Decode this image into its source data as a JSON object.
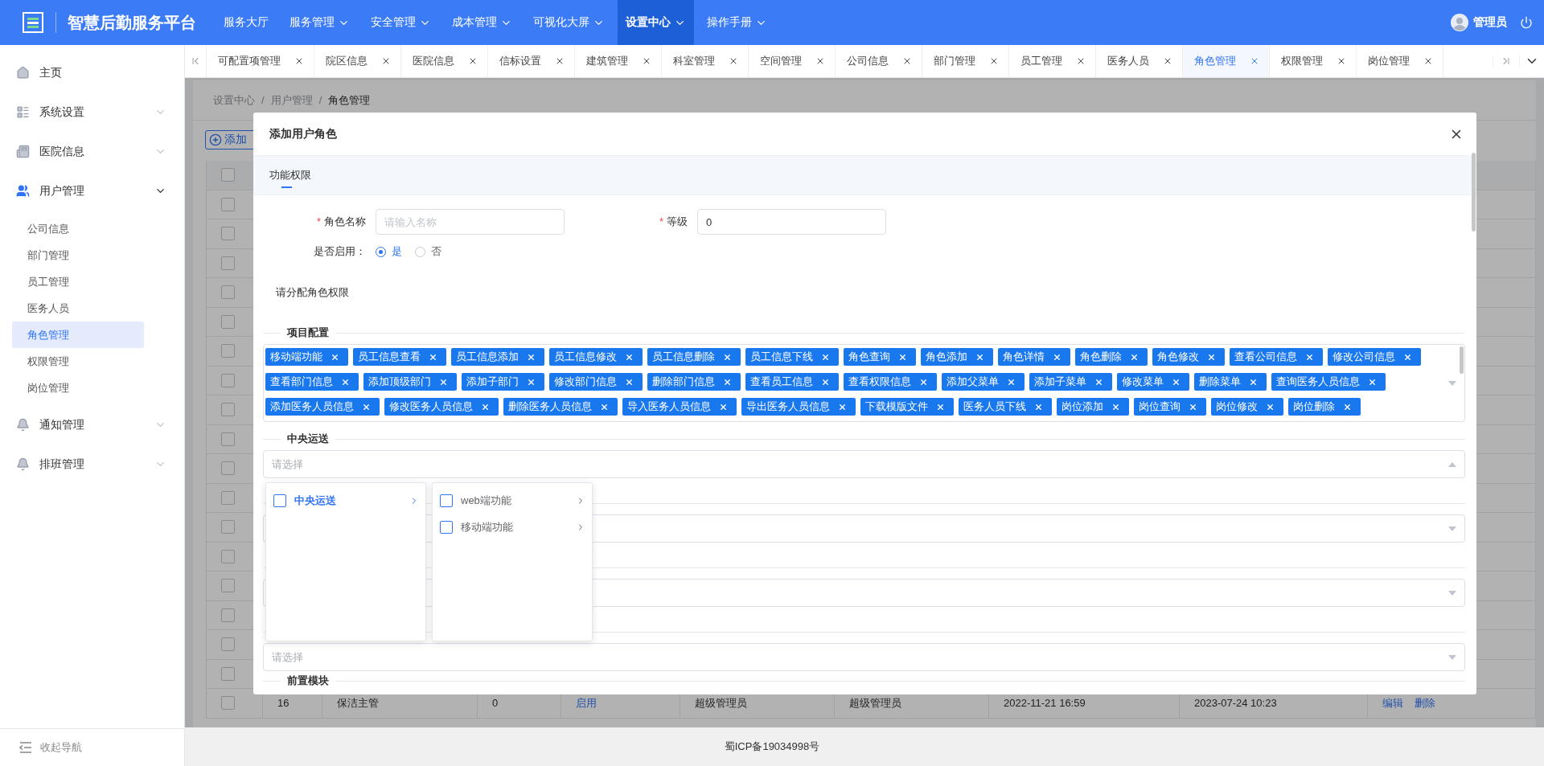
{
  "header": {
    "title": "智慧后勤服务平台",
    "nav": [
      {
        "label": "服务大厅",
        "has_menu": false,
        "selected": false
      },
      {
        "label": "服务管理",
        "has_menu": true,
        "selected": false
      },
      {
        "label": "安全管理",
        "has_menu": true,
        "selected": false
      },
      {
        "label": "成本管理",
        "has_menu": true,
        "selected": false
      },
      {
        "label": "可视化大屏",
        "has_menu": true,
        "selected": false
      },
      {
        "label": "设置中心",
        "has_menu": true,
        "selected": true
      },
      {
        "label": "操作手册",
        "has_menu": true,
        "selected": false
      }
    ],
    "user": "管理员"
  },
  "sidebar": {
    "items": [
      {
        "label": "主页"
      },
      {
        "label": "系统设置",
        "expanded": false
      },
      {
        "label": "医院信息",
        "expanded": false
      },
      {
        "label": "用户管理",
        "expanded": true,
        "children": [
          {
            "label": "公司信息",
            "selected": false
          },
          {
            "label": "部门管理",
            "selected": false
          },
          {
            "label": "员工管理",
            "selected": false
          },
          {
            "label": "医务人员",
            "selected": false
          },
          {
            "label": "角色管理",
            "selected": true
          },
          {
            "label": "权限管理",
            "selected": false
          },
          {
            "label": "岗位管理",
            "selected": false
          }
        ]
      },
      {
        "label": "通知管理",
        "expanded": false
      },
      {
        "label": "排班管理",
        "expanded": false
      }
    ],
    "collapse": "收起导航"
  },
  "tabs": [
    {
      "label": "可配置项管理",
      "selected": false
    },
    {
      "label": "院区信息",
      "selected": false
    },
    {
      "label": "医院信息",
      "selected": false
    },
    {
      "label": "信标设置",
      "selected": false
    },
    {
      "label": "建筑管理",
      "selected": false
    },
    {
      "label": "科室管理",
      "selected": false
    },
    {
      "label": "空间管理",
      "selected": false
    },
    {
      "label": "公司信息",
      "selected": false
    },
    {
      "label": "部门管理",
      "selected": false
    },
    {
      "label": "员工管理",
      "selected": false
    },
    {
      "label": "医务人员",
      "selected": false
    },
    {
      "label": "角色管理",
      "selected": true
    },
    {
      "label": "权限管理",
      "selected": false
    },
    {
      "label": "岗位管理",
      "selected": false
    }
  ],
  "breadcrumb": [
    {
      "label": "设置中心",
      "kind": "crumb"
    },
    {
      "label": "/",
      "kind": "separator"
    },
    {
      "label": "用户管理",
      "kind": "crumb"
    },
    {
      "label": "/",
      "kind": "separator"
    },
    {
      "label": "角色管理",
      "kind": "current"
    }
  ],
  "add_button": "添加",
  "table": {
    "header_checked": false,
    "rows": [
      {
        "checked": false
      },
      {
        "checked": false
      },
      {
        "checked": false
      },
      {
        "checked": false
      },
      {
        "checked": false
      },
      {
        "checked": false
      },
      {
        "checked": false
      },
      {
        "checked": false
      },
      {
        "checked": false
      },
      {
        "checked": false
      },
      {
        "checked": false
      },
      {
        "checked": false
      },
      {
        "checked": false
      },
      {
        "checked": false
      },
      {
        "checked": false
      },
      {
        "checked": false
      },
      {
        "checked": false
      },
      {
        "checked": false,
        "cells": [
          {
            "text": "16",
            "kind": "text"
          },
          {
            "text": "保洁主管",
            "kind": "text"
          },
          {
            "text": "0",
            "kind": "text"
          },
          {
            "text": "启用",
            "kind": "link"
          },
          {
            "text": "超级管理员",
            "kind": "text"
          },
          {
            "text": "超级管理员",
            "kind": "text"
          },
          {
            "text": "2022-11-21 16:59",
            "kind": "text"
          },
          {
            "text": "2023-07-24 10:23",
            "kind": "text"
          }
        ],
        "actions": [
          "编辑",
          "删除"
        ]
      }
    ]
  },
  "dialog": {
    "title": "添加用户角色",
    "tabs": [
      {
        "label": "功能权限",
        "selected": true
      }
    ],
    "fields": [
      {
        "marker": "*",
        "label": "角色名称",
        "placeholder": "请输入名称"
      },
      {
        "marker": "*",
        "label": "等级",
        "value": "0"
      }
    ],
    "enable": {
      "label": "是否启用：",
      "options": [
        {
          "label": "是",
          "selected": true
        },
        {
          "label": "否",
          "selected": false
        }
      ]
    },
    "hint": "请分配角色权限",
    "sections": [
      {
        "title": "项目配置",
        "kind": "tags",
        "open": false,
        "tags": [
          "移动端功能",
          "员工信息查看",
          "员工信息添加",
          "员工信息修改",
          "员工信息删除",
          "员工信息下线",
          "角色查询",
          "角色添加",
          "角色详情",
          "角色删除",
          "角色修改",
          "查看公司信息",
          "修改公司信息",
          "查看部门信息",
          "添加顶级部门",
          "添加子部门",
          "修改部门信息",
          "删除部门信息",
          "查看员工信息",
          "查看权限信息",
          "添加父菜单",
          "添加子菜单",
          "修改菜单",
          "删除菜单",
          "查询医务人员信息",
          "添加医务人员信息",
          "修改医务人员信息",
          "删除医务人员信息",
          "导入医务人员信息",
          "导出医务人员信息",
          "下载模版文件",
          "医务人员下线",
          "岗位添加",
          "岗位查询",
          "岗位修改",
          "岗位删除"
        ]
      },
      {
        "title": "中央运送",
        "kind": "select",
        "placeholder": "请选择",
        "open": true,
        "cascader": {
          "columns": [
            {
              "items": [
                {
                  "label": "中央运送",
                  "checked": false,
                  "selected": true
                }
              ]
            },
            {
              "items": [
                {
                  "label": "web端功能",
                  "checked": false,
                  "selected": false
                },
                {
                  "label": "移动端功能",
                  "checked": false,
                  "selected": false
                }
              ]
            }
          ]
        }
      },
      {
        "kind": "select",
        "open": false
      },
      {
        "kind": "select",
        "open": false
      },
      {
        "kind": "select",
        "placeholder": "请选择",
        "open": false
      },
      {
        "title": "前置模块",
        "kind": "heading"
      }
    ]
  },
  "footer": "蜀ICP备19034998号"
}
